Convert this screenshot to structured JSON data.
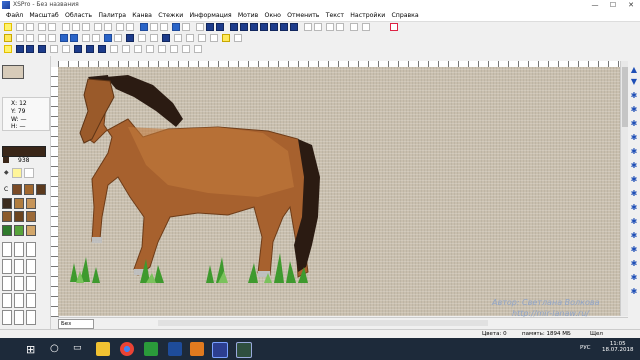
{
  "window": {
    "title": "XSPro - Без названия",
    "minimize": "—",
    "maximize": "☐",
    "close": "✕"
  },
  "menu": [
    "Файл",
    "Масштаб",
    "Область",
    "Палитра",
    "Канва",
    "Стежки",
    "Информация",
    "Мотив",
    "Окно",
    "Отменить",
    "Текст",
    "Настройки",
    "Справка"
  ],
  "coords": {
    "x_label": "X:",
    "x": "12",
    "y_label": "Y:",
    "y": "79",
    "w_label": "W:",
    "w": "—",
    "h_label": "H:",
    "h": "—"
  },
  "color_number": "938",
  "palette_header": "С",
  "swatches": [
    "#7a4a26",
    "#a0672f",
    "#5b3a1e",
    "#3b2a1c",
    "#b17d3f",
    "#c6955a",
    "#8b5a2b",
    "#6b4420",
    "#2f7a2c",
    "#58a33c",
    "#9c6a38",
    "#d2a66a"
  ],
  "tab": "Без названия",
  "status": {
    "colors": "Цвета: 0",
    "memory": "память: 1894 МБ",
    "units": "Щел"
  },
  "watermark": {
    "line1": "Автор: Светлана Волкова",
    "line2": "http://mir-lanaw.ru/"
  },
  "taskbar": {
    "time": "11:05",
    "date": "18.07.2018",
    "lang": "РУС"
  },
  "icons": [
    "app-icon",
    "windows-start-icon",
    "search-icon",
    "task-view-icon",
    "explorer-icon",
    "chrome-icon",
    "xsp-icon",
    "orange-app-icon",
    "green-app-icon",
    "c-app-icon"
  ]
}
